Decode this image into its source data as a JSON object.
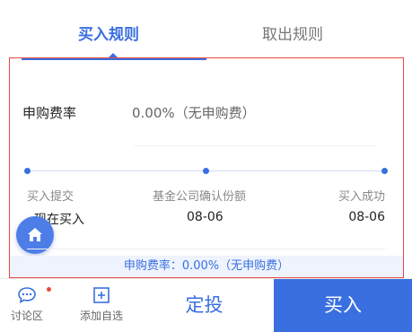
{
  "tabs": {
    "buy_rules": "买入规则",
    "redeem_rules": "取出规则"
  },
  "fee": {
    "label": "申购费率",
    "value": "0.00%（无申购费）"
  },
  "timeline": {
    "steps": [
      {
        "label": "买入提交",
        "date": "现在买入"
      },
      {
        "label": "基金公司确认份额",
        "date": "08-06"
      },
      {
        "label": "买入成功",
        "date": "08-06"
      }
    ]
  },
  "notice": "申购费率：0.00%（无申购费）",
  "bottom_bar": {
    "discuss_label": "讨论区",
    "watchlist_label": "添加自选",
    "dingtou_label": "定投",
    "buy_label": "买入"
  },
  "colors": {
    "accent": "#3a6fe0",
    "highlight_border": "#e8483f",
    "notice_bg": "#eef3fd"
  },
  "icons": {
    "home": "home-icon",
    "discuss": "chat-bubble-icon",
    "watchlist": "plus-square-icon"
  }
}
